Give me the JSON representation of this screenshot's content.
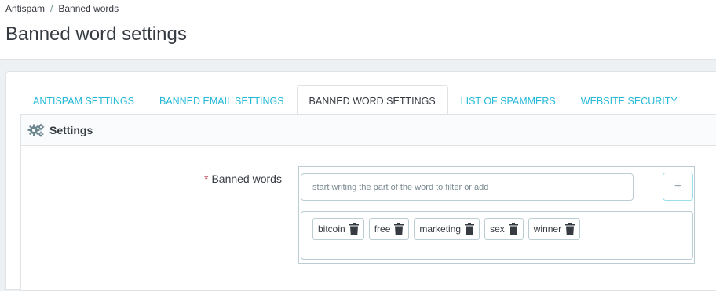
{
  "breadcrumb": {
    "parent": "Antispam",
    "separator": "/",
    "current": "Banned words"
  },
  "page": {
    "title": "Banned word settings"
  },
  "tabs": [
    {
      "label": "ANTISPAM SETTINGS"
    },
    {
      "label": "BANNED EMAIL SETTINGS"
    },
    {
      "label": "BANNED WORD SETTINGS",
      "active": true
    },
    {
      "label": "LIST OF SPAMMERS"
    },
    {
      "label": "WEBSITE SECURITY"
    }
  ],
  "panel": {
    "heading": "Settings",
    "icon": "gears-icon"
  },
  "form": {
    "required_mark": "*",
    "field_label": "Banned words",
    "input_placeholder": "start writing the part of the word to filter or add",
    "input_value": "",
    "add_label": "+",
    "words": [
      "bitcoin",
      "free",
      "marketing",
      "sex",
      "winner"
    ],
    "chip_icon": "trash-icon"
  },
  "colors": {
    "accent": "#25b9d7",
    "required": "#c05c67",
    "text": "#363a41",
    "border": "#bbcdd2"
  }
}
